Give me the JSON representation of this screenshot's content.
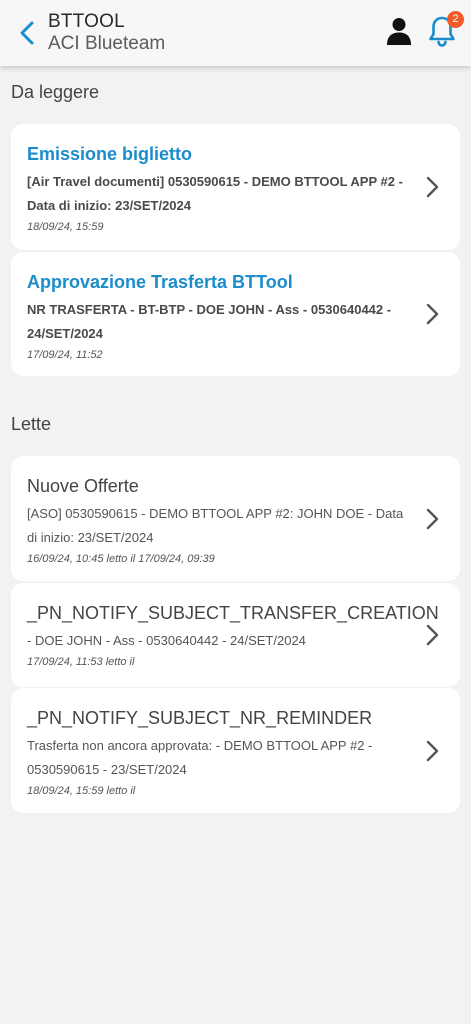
{
  "header": {
    "title": "BTTOOL",
    "subtitle": "ACI Blueteam",
    "notification_count": "2",
    "back_icon": "chevron-left-icon",
    "user_icon": "user-icon",
    "bell_icon": "bell-icon",
    "accent_color": "#1b8ccc",
    "badge_color": "#f05a28"
  },
  "sections": {
    "unread_label": "Da leggere",
    "read_label": "Lette"
  },
  "unread": [
    {
      "title": "Emissione biglietto",
      "body": "[Air Travel documenti] 0530590615 - DEMO BTTOOL APP #2 - Data di inizio: 23/SET/2024",
      "time": "18/09/24, 15:59"
    },
    {
      "title": "Approvazione Trasferta BTTool",
      "body": "NR TRASFERTA - BT-BTP - DOE JOHN - Ass - 0530640442 - 24/SET/2024",
      "time": "17/09/24, 11:52"
    }
  ],
  "read": [
    {
      "title": "Nuove Offerte",
      "body": "[ASO] 0530590615 - DEMO BTTOOL APP #2: JOHN DOE - Data di inizio: 23/SET/2024",
      "time": "16/09/24, 10:45 letto il 17/09/24, 09:39"
    },
    {
      "title": "_PN_NOTIFY_SUBJECT_TRANSFER_CREATION",
      "body": "- DOE JOHN - Ass - 0530640442 - 24/SET/2024",
      "time": "17/09/24, 11:53 letto il"
    },
    {
      "title": "_PN_NOTIFY_SUBJECT_NR_REMINDER",
      "body": "Trasferta non ancora approvata: - DEMO BTTOOL APP #2 - 0530590615 - 23/SET/2024",
      "time": "18/09/24, 15:59 letto il"
    }
  ]
}
